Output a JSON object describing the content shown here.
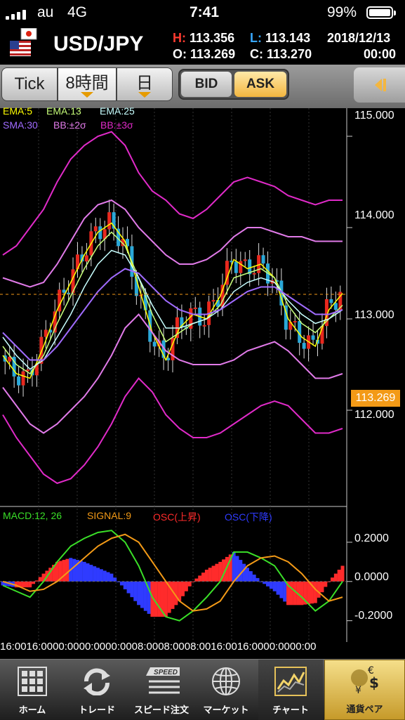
{
  "status_bar": {
    "carrier": "au",
    "network": "4G",
    "time": "7:41",
    "battery": "99%",
    "battery_level": 0.99
  },
  "header": {
    "pair": "USD/JPY",
    "high_label": "H:",
    "high": "113.356",
    "low_label": "L:",
    "low": "113.143",
    "open_label": "O:",
    "open": "113.269",
    "close_label": "C:",
    "close": "113.270",
    "date": "2018/12/13",
    "time": "00:00"
  },
  "toolbar": {
    "tick": "Tick",
    "hour8": "8時間",
    "day": "日",
    "bid": "BID",
    "ask": "ASK",
    "selected_side": "ASK",
    "selected_period": "8時間"
  },
  "indicators": {
    "ema5": "EMA:5",
    "ema13": "EMA:13",
    "ema25": "EMA:25",
    "sma30": "SMA:30",
    "bb2": "BB:±2σ",
    "bb3": "BB:±3σ",
    "macd": "MACD:12, 26",
    "signal": "SIGNAL:9",
    "osc_up": "OSC(上昇)",
    "osc_down": "OSC(下降)"
  },
  "price_axis": {
    "labels": [
      "115.000",
      "114.000",
      "113.000",
      "112.000"
    ],
    "current": "113.269"
  },
  "macd_axis": {
    "labels": [
      "0.2000",
      "0.0000",
      "-0.2000"
    ]
  },
  "time_axis": "16:0016:0000:0000:0000:0008:0008:0008:0016:0016:0000:0000:00",
  "chart_data": [
    {
      "type": "line",
      "title": "",
      "ylim": [
        111.0,
        115.2
      ],
      "current_price": 113.269,
      "series_colors": {
        "ema5": "#ffff00",
        "ema13": "#c8ff7a",
        "ema25": "#c8ffff",
        "sma30": "#a06bff",
        "bb2": "#e07ae8",
        "bb3": "#e02ac8",
        "candle_up": "#e8281e",
        "candle_down": "#2aa8d8"
      },
      "series": [
        {
          "name": "EMA:5",
          "values": [
            112.6,
            112.4,
            112.35,
            112.7,
            113.1,
            113.4,
            113.7,
            113.95,
            114.05,
            113.85,
            113.35,
            112.85,
            112.55,
            112.9,
            113.05,
            113.0,
            113.25,
            113.65,
            113.55,
            113.6,
            113.45,
            113.0,
            112.8,
            112.7,
            113.1,
            113.28
          ]
        },
        {
          "name": "EMA:13",
          "values": [
            112.7,
            112.5,
            112.4,
            112.6,
            112.95,
            113.25,
            113.55,
            113.8,
            113.95,
            113.8,
            113.45,
            113.05,
            112.75,
            112.85,
            112.95,
            113.0,
            113.15,
            113.45,
            113.5,
            113.55,
            113.45,
            113.15,
            112.95,
            112.85,
            113.0,
            113.15
          ]
        },
        {
          "name": "EMA:25",
          "values": [
            112.8,
            112.6,
            112.45,
            112.55,
            112.8,
            113.05,
            113.35,
            113.6,
            113.75,
            113.7,
            113.45,
            113.15,
            112.9,
            112.9,
            112.95,
            113.0,
            113.1,
            113.3,
            113.4,
            113.45,
            113.4,
            113.2,
            113.05,
            112.95,
            113.0,
            113.1
          ]
        },
        {
          "name": "SMA:30",
          "values": [
            112.85,
            112.7,
            112.55,
            112.55,
            112.7,
            112.9,
            113.1,
            113.3,
            113.45,
            113.55,
            113.5,
            113.35,
            113.2,
            113.1,
            113.05,
            113.05,
            113.1,
            113.2,
            113.3,
            113.35,
            113.35,
            113.25,
            113.15,
            113.05,
            113.05,
            113.1
          ]
        },
        {
          "name": "BB:+2σ",
          "values": [
            113.45,
            113.4,
            113.35,
            113.4,
            113.6,
            113.85,
            114.1,
            114.25,
            114.3,
            114.2,
            114.0,
            113.85,
            113.7,
            113.6,
            113.6,
            113.65,
            113.75,
            113.9,
            114.0,
            114.0,
            113.95,
            113.9,
            113.9,
            113.85,
            113.85,
            113.85
          ]
        },
        {
          "name": "BB:-2σ",
          "values": [
            112.25,
            112.05,
            111.85,
            111.75,
            111.85,
            112.0,
            112.15,
            112.35,
            112.6,
            112.9,
            113.05,
            112.85,
            112.65,
            112.55,
            112.5,
            112.5,
            112.5,
            112.55,
            112.65,
            112.7,
            112.75,
            112.65,
            112.5,
            112.35,
            112.35,
            112.4
          ]
        },
        {
          "name": "BB:+3σ",
          "values": [
            113.7,
            113.8,
            114.0,
            114.2,
            114.5,
            114.75,
            114.9,
            115.0,
            115.05,
            114.9,
            114.6,
            114.4,
            114.3,
            114.15,
            114.1,
            114.2,
            114.35,
            114.5,
            114.55,
            114.5,
            114.45,
            114.35,
            114.3,
            114.25,
            114.3,
            114.3
          ]
        },
        {
          "name": "BB:-3σ",
          "values": [
            111.95,
            111.7,
            111.5,
            111.3,
            111.2,
            111.25,
            111.4,
            111.6,
            111.85,
            112.15,
            112.35,
            112.2,
            111.95,
            111.8,
            111.7,
            111.7,
            111.75,
            111.85,
            111.95,
            112.05,
            112.1,
            112.05,
            111.9,
            111.75,
            111.75,
            111.8
          ]
        }
      ]
    },
    {
      "type": "line",
      "title": "",
      "ylim": [
        -0.28,
        0.3
      ],
      "series": [
        {
          "name": "MACD:12, 26",
          "values": [
            -0.02,
            -0.05,
            -0.08,
            0.0,
            0.1,
            0.18,
            0.22,
            0.25,
            0.26,
            0.2,
            0.08,
            -0.08,
            -0.18,
            -0.2,
            -0.15,
            -0.08,
            0.0,
            0.15,
            0.15,
            0.12,
            0.08,
            -0.02,
            -0.08,
            -0.15,
            -0.1,
            0.0
          ]
        },
        {
          "name": "SIGNAL:9",
          "values": [
            0.0,
            -0.02,
            -0.05,
            -0.04,
            0.0,
            0.06,
            0.12,
            0.18,
            0.22,
            0.24,
            0.2,
            0.1,
            0.0,
            -0.1,
            -0.15,
            -0.14,
            -0.1,
            0.0,
            0.08,
            0.12,
            0.13,
            0.1,
            0.04,
            -0.04,
            -0.1,
            -0.08
          ]
        },
        {
          "name": "OSC(上昇)",
          "values": [
            -0.02,
            -0.03,
            -0.03,
            0.04,
            0.1,
            0.12,
            0.1,
            0.07,
            0.04,
            -0.04,
            -0.12,
            -0.18,
            -0.18,
            -0.1,
            0.0,
            0.06,
            0.1,
            0.15,
            0.07,
            0.0,
            -0.05,
            -0.12,
            -0.12,
            -0.11,
            0.0,
            0.08
          ]
        }
      ]
    }
  ]
}
